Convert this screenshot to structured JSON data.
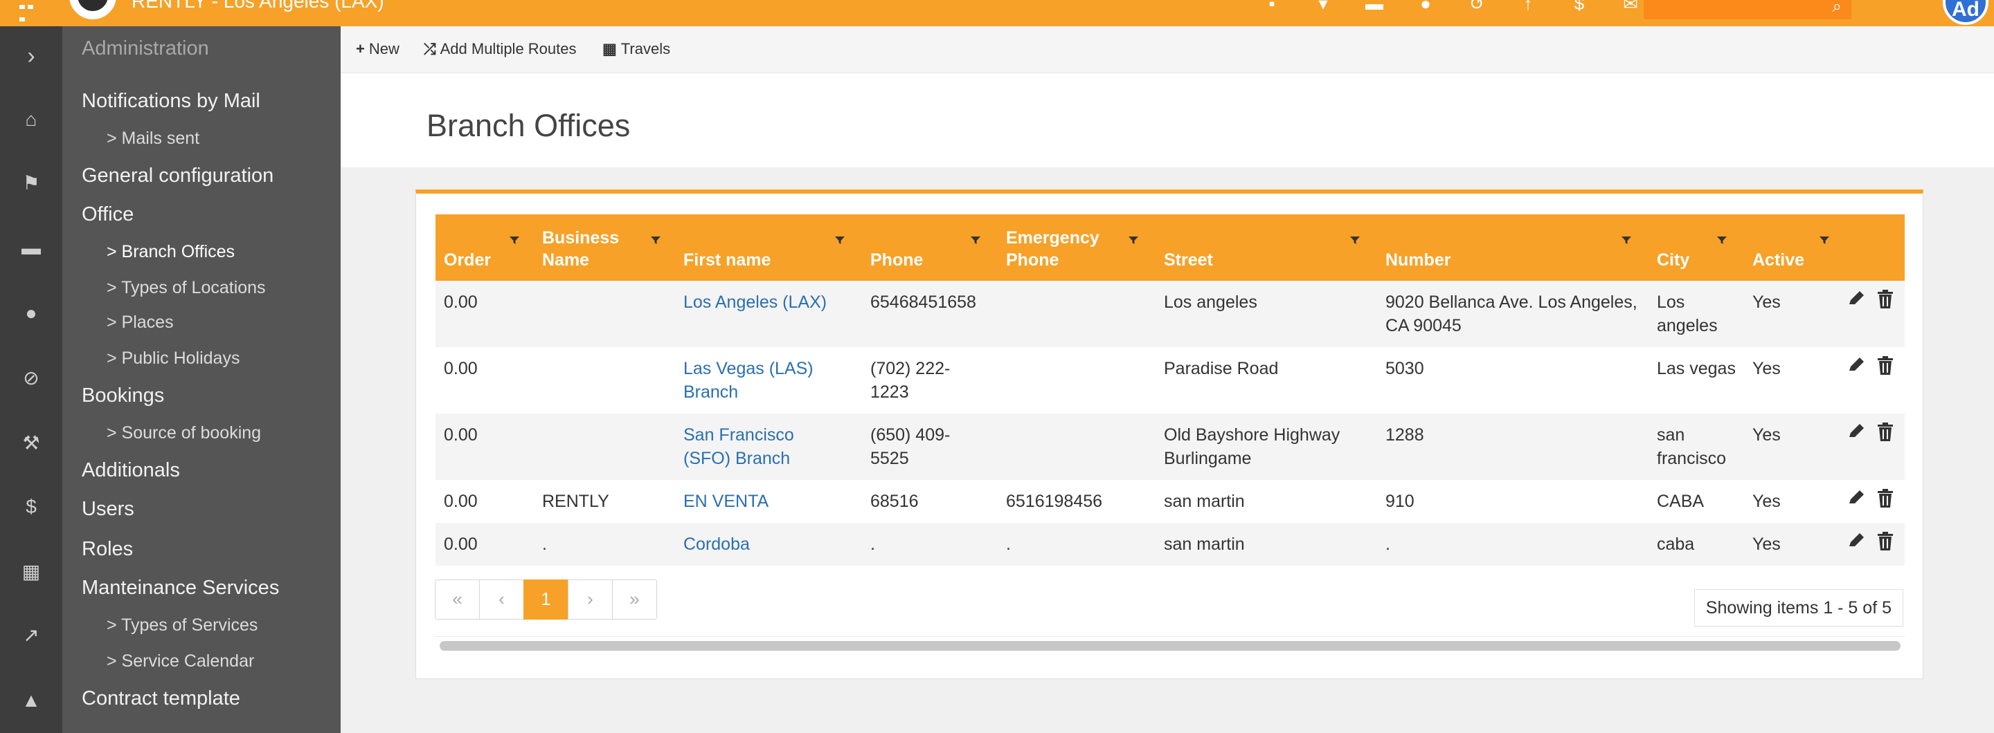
{
  "header": {
    "app_title": "RENTLY - Los Angeles (LAX)",
    "avatar_initials": "Ad",
    "icons": [
      "building-icon",
      "map-marker-icon",
      "car-icon",
      "user-icon",
      "history-icon",
      "dollar-chart-icon",
      "dollar-icon",
      "envelope-icon"
    ],
    "accent_color": "#f7a128"
  },
  "rail": {
    "icons": [
      "chevron-right-icon",
      "home-icon",
      "flag-icon",
      "car-icon",
      "user-icon",
      "ban-icon",
      "wrench-icon",
      "dollar-icon",
      "calculator-icon",
      "chart-line-icon",
      "warning-icon"
    ]
  },
  "sidebar": {
    "heading": "Administration",
    "items": [
      {
        "label": "Notifications by Mail"
      },
      {
        "label": "> Mails sent",
        "sub": true
      },
      {
        "label": "General configuration"
      },
      {
        "label": "Office"
      },
      {
        "label": "> Branch Offices",
        "sub": true,
        "active": true
      },
      {
        "label": "> Types of Locations",
        "sub": true
      },
      {
        "label": "> Places",
        "sub": true
      },
      {
        "label": "> Public Holidays",
        "sub": true
      },
      {
        "label": "Bookings"
      },
      {
        "label": "> Source of booking",
        "sub": true
      },
      {
        "label": "Additionals"
      },
      {
        "label": "Users"
      },
      {
        "label": "Roles"
      },
      {
        "label": "Manteinance Services"
      },
      {
        "label": "> Types of Services",
        "sub": true
      },
      {
        "label": "> Service Calendar",
        "sub": true
      },
      {
        "label": "Contract template"
      }
    ]
  },
  "toolbar": {
    "new_label": "New",
    "add_routes_label": "Add Multiple Routes",
    "travels_label": "Travels"
  },
  "page": {
    "title": "Branch Offices"
  },
  "table": {
    "columns": [
      "Order",
      "Business Name",
      "First name",
      "Phone",
      "Emergency Phone",
      "Street",
      "Number",
      "City",
      "Active"
    ],
    "rows": [
      [
        "0.00",
        "",
        "Los Angeles (LAX)",
        "65468451658",
        "",
        "Los angeles",
        "9020 Bellanca Ave. Los Angeles, CA 90045",
        "Los angeles",
        "Yes"
      ],
      [
        "0.00",
        "",
        "Las Vegas (LAS) Branch",
        "(702) 222-1223",
        "",
        "Paradise Road",
        "5030",
        "Las vegas",
        "Yes"
      ],
      [
        "0.00",
        "",
        "San Francisco (SFO) Branch",
        "(650) 409-5525",
        "",
        "Old Bayshore Highway Burlingame",
        "1288",
        "san francisco",
        "Yes"
      ],
      [
        "0.00",
        "RENTLY",
        "EN VENTA",
        "68516",
        "6516198456",
        "san martin",
        "910",
        "CABA",
        "Yes"
      ],
      [
        "0.00",
        ".",
        "Cordoba",
        ".",
        ".",
        "san martin",
        ".",
        "caba",
        "Yes"
      ]
    ]
  },
  "pager": {
    "first": "«",
    "prev": "‹",
    "current": "1",
    "next": "›",
    "last": "»",
    "summary": "Showing items 1 - 5 of 5"
  }
}
